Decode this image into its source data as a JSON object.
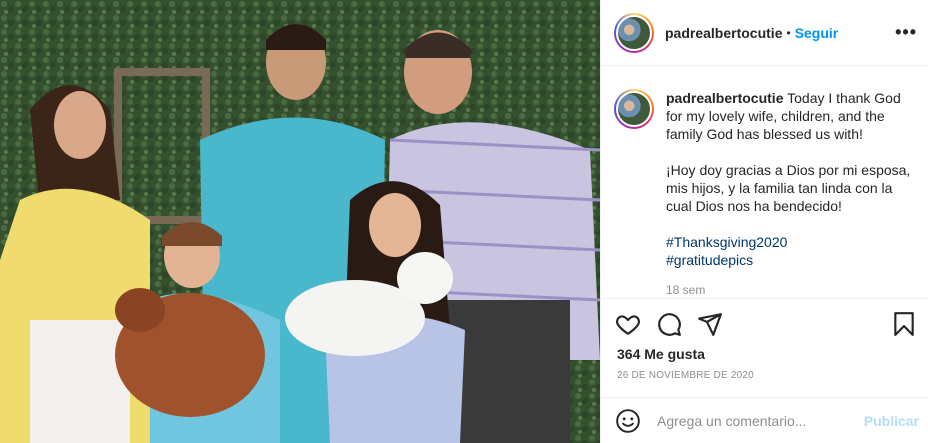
{
  "post": {
    "username": "padrealbertocutie",
    "separator": "•",
    "follow_label": "Seguir",
    "more_label": "•••"
  },
  "caption": {
    "username": "padrealbertocutie",
    "text_en": "Today I thank God for my lovely wife, children, and the family God has blessed us with!",
    "text_es": "¡Hoy doy gracias a Dios por mi esposa, mis hijos, y la familia tan linda con la cual Dios nos ha bendecido!",
    "hashtags": [
      "#Thanksgiving2020",
      "#gratitudepics"
    ],
    "time_ago": "18 sem"
  },
  "actions": {
    "icons": [
      "heart-icon",
      "comment-icon",
      "share-icon",
      "bookmark-icon"
    ]
  },
  "likes_text": "364 Me gusta",
  "date_text": "26 DE NOVIEMBRE DE 2020",
  "composer": {
    "placeholder": "Agrega un comentario...",
    "post_label": "Publicar"
  },
  "colors": {
    "accent": "#0095f6",
    "link": "#00376b",
    "muted": "#8e8e8e",
    "post_disabled": "#b2dffc"
  }
}
